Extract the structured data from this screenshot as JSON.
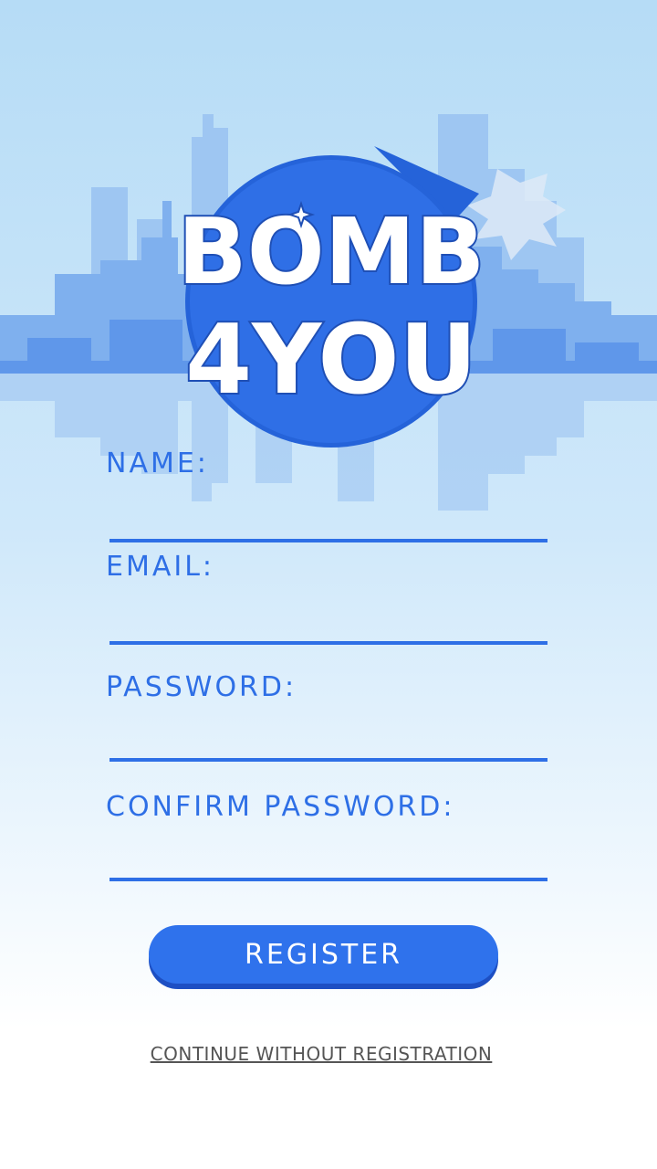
{
  "logo": {
    "line1": "BOMB",
    "line2": "4YOU"
  },
  "form": {
    "fields": [
      {
        "label": "NAME:",
        "value": ""
      },
      {
        "label": "EMAIL:",
        "value": ""
      },
      {
        "label": "PASSWORD:",
        "value": ""
      },
      {
        "label": "CONFIRM PASSWORD:",
        "value": ""
      }
    ],
    "register_label": "REGISTER",
    "continue_label": "CONTINUE WITHOUT REGISTRATION"
  },
  "colors": {
    "accent": "#2e6fe6",
    "button_shadow": "#1d4fc3",
    "sky_top": "#b6dcf6",
    "link": "#555555"
  },
  "icons": {
    "logo": "bomb-4you-logo",
    "fuse_spark": "spark-icon",
    "background": "city-skyline"
  }
}
